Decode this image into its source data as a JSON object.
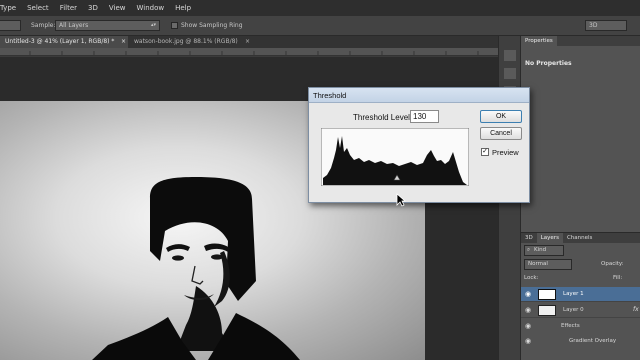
{
  "menu": [
    "Type",
    "Select",
    "Filter",
    "3D",
    "View",
    "Window",
    "Help"
  ],
  "options_bar": {
    "sample_label": "Sample:",
    "sample_value": "All Layers",
    "show_sampling_ring": "Show Sampling Ring",
    "workspace_button": "3D"
  },
  "tabs": [
    {
      "label": "Untitled-3 @ 41% (Layer 1, RGB/8) *"
    },
    {
      "label": "watson-book.jpg @ 88.1% (RGB/8)"
    }
  ],
  "tab_close_glyph": "×",
  "properties_panel": {
    "tab": "Properties",
    "content": "No Properties"
  },
  "layers_panel": {
    "tabs": [
      "3D",
      "Layers",
      "Channels"
    ],
    "filter_kind": "Kind",
    "blend_mode": "Normal",
    "opacity_label": "Opacity:",
    "lock_label": "Lock:",
    "fill_label": "Fill:",
    "layers": [
      "Layer 1",
      "Layer 0"
    ],
    "effects_label": "Effects",
    "effect_item": "Gradient Overlay",
    "fx_glyph": "fx"
  },
  "threshold_dialog": {
    "title": "Threshold",
    "level_label": "Threshold Level:",
    "level_value": "130",
    "ok": "OK",
    "cancel": "Cancel",
    "preview": "Preview",
    "preview_checked": true
  },
  "colors": {
    "app_bg": "#3b3b3b",
    "menubar_bg": "#2e2e2e",
    "dialog_bg": "#e8e8e8",
    "selected_layer": "#4a6e96"
  }
}
